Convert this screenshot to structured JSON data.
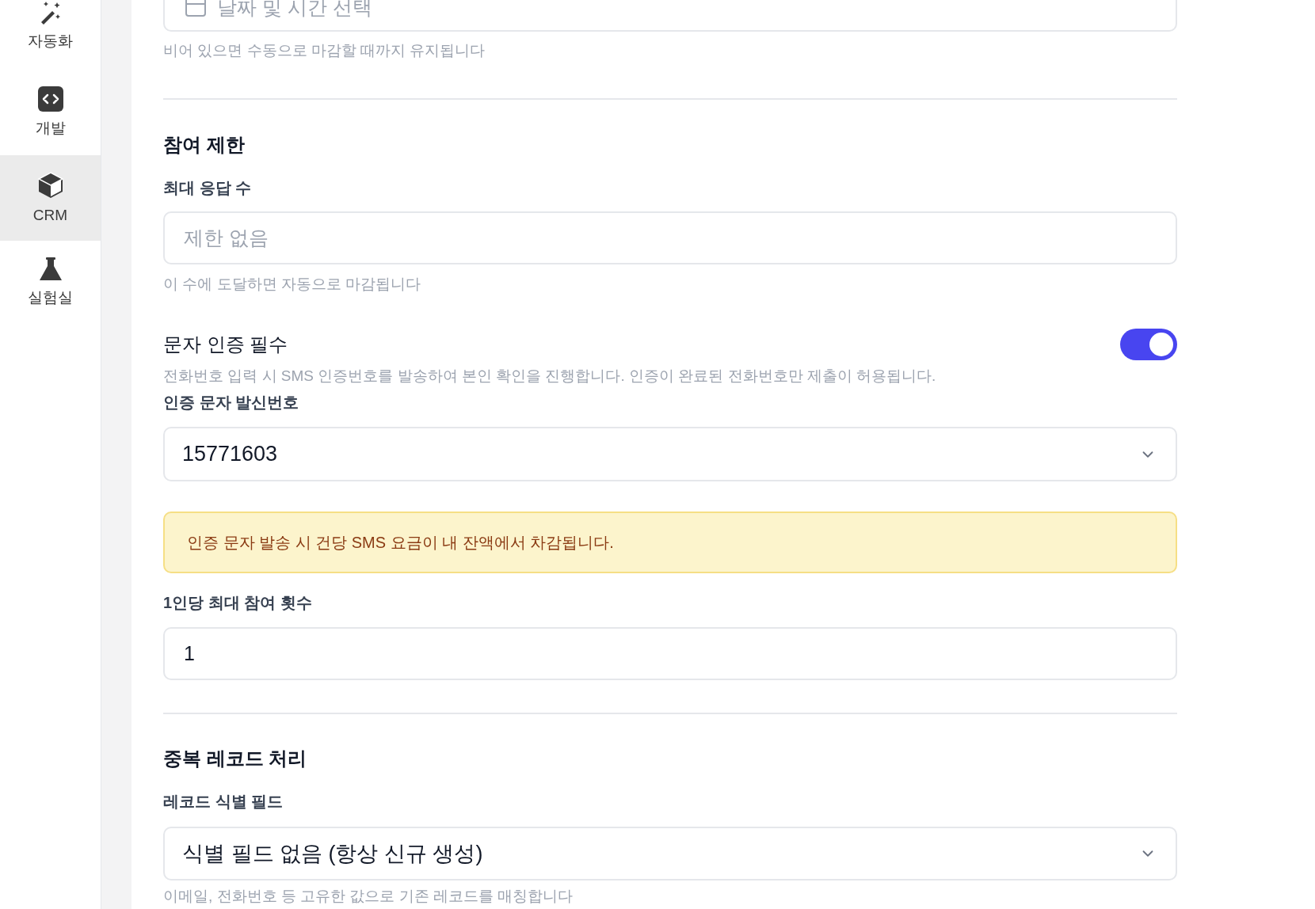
{
  "sidebar": {
    "items": [
      {
        "kind": "wand",
        "label": "자동화",
        "selected": false
      },
      {
        "kind": "code",
        "label": "개발",
        "selected": false
      },
      {
        "kind": "cube",
        "label": "CRM",
        "selected": true
      },
      {
        "kind": "flask",
        "label": "실험실",
        "selected": false
      }
    ]
  },
  "form": {
    "date_field": {
      "placeholder": "날짜 및 시간 선택"
    },
    "date_hint": "비어 있으면 수동으로 마감할 때까지 유지됩니다",
    "limit_section": {
      "title": "참여 제한",
      "max_responses": {
        "label": "최대 응답 수",
        "placeholder": "제한 없음",
        "hint": "이 수에 도달하면 자동으로 마감됩니다"
      },
      "sms_verification": {
        "label": "문자 인증 필수",
        "on": true,
        "description": "전화번호 입력 시 SMS 인증번호를 발송하여 본인 확인을 진행합니다. 인증이 완료된 전화번호만 제출이 허용됩니다."
      },
      "sender_number": {
        "label": "인증 문자 발신번호",
        "value": "15771603"
      },
      "warning": "인증 문자 발송 시 건당 SMS 요금이 내 잔액에서 차감됩니다.",
      "per_person": {
        "label": "1인당 최대 참여 횟수",
        "value": "1"
      }
    },
    "duplicate_section": {
      "title": "중복 레코드 처리",
      "identifier_field": {
        "label": "레코드 식별 필드",
        "value": "식별 필드 없음 (항상 신규 생성)",
        "hint": "이메일, 전화번호 등 고유한 값으로 기존 레코드를 매칭합니다"
      }
    }
  }
}
